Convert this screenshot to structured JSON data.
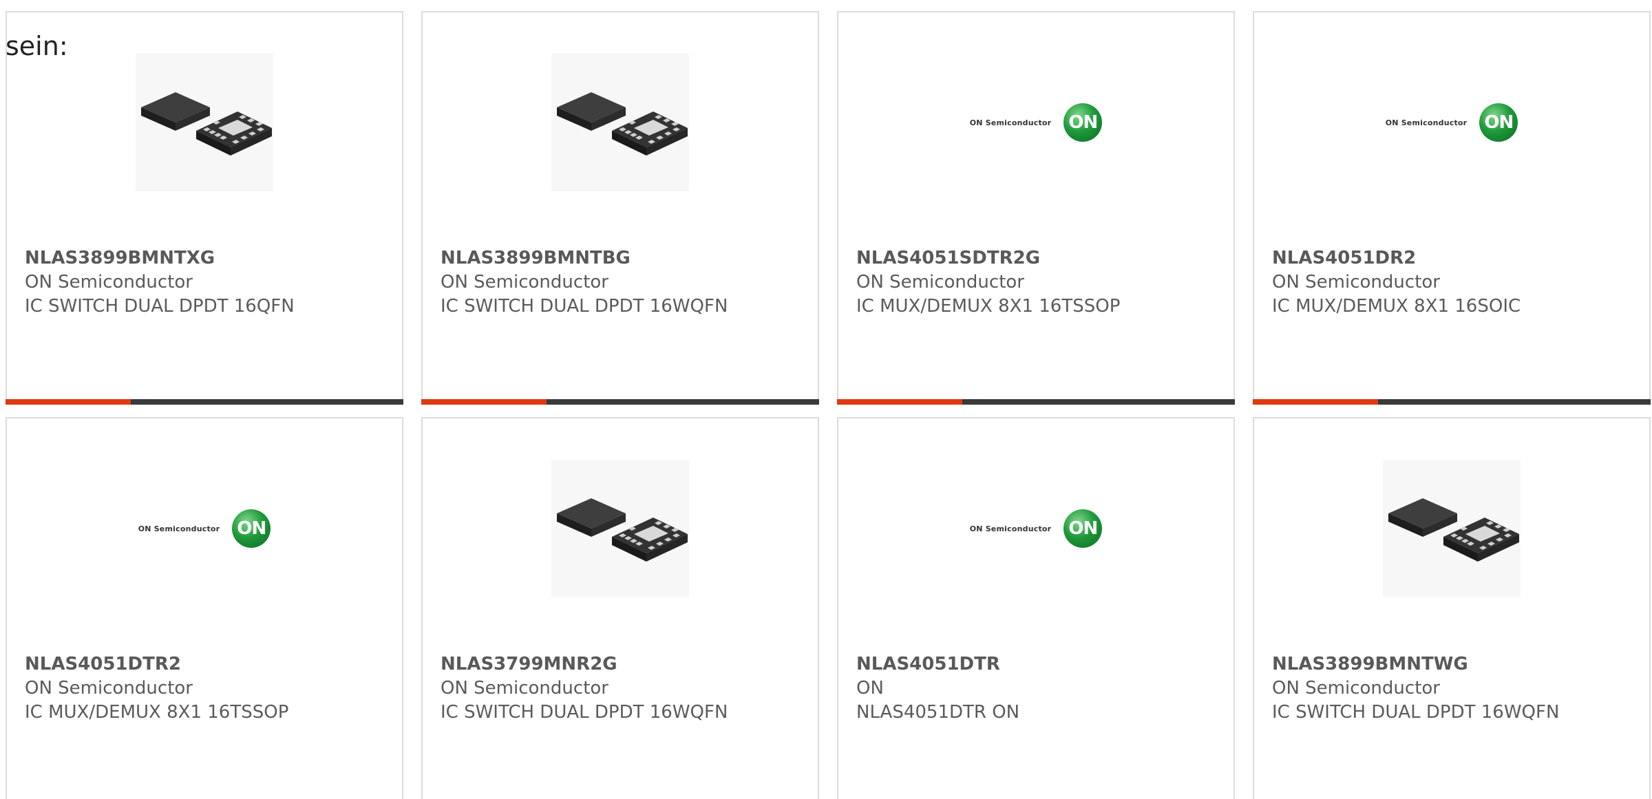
{
  "intro_text": "sein:",
  "logo": {
    "wordmark": "ON Semiconductor",
    "badge": "ON"
  },
  "colors": {
    "accent": "#e03a10",
    "bar": "#3a3a3a",
    "text": "#5a5a5a",
    "border": "#dcdcdc"
  },
  "cards": [
    {
      "part": "NLAS3899BMNTXG",
      "manufacturer": "ON Semiconductor",
      "description": "IC SWITCH DUAL DPDT 16QFN",
      "image": "chip-photo"
    },
    {
      "part": "NLAS3899BMNTBG",
      "manufacturer": "ON Semiconductor",
      "description": "IC SWITCH DUAL DPDT 16WQFN",
      "image": "chip-photo"
    },
    {
      "part": "NLAS4051SDTR2G",
      "manufacturer": "ON Semiconductor",
      "description": "IC MUX/DEMUX 8X1 16TSSOP",
      "image": "on-logo"
    },
    {
      "part": "NLAS4051DR2",
      "manufacturer": "ON Semiconductor",
      "description": "IC MUX/DEMUX 8X1 16SOIC",
      "image": "on-logo"
    },
    {
      "part": "NLAS4051DTR2",
      "manufacturer": "ON Semiconductor",
      "description": "IC MUX/DEMUX 8X1 16TSSOP",
      "image": "on-logo"
    },
    {
      "part": "NLAS3799MNR2G",
      "manufacturer": "ON Semiconductor",
      "description": "IC SWITCH DUAL DPDT 16WQFN",
      "image": "chip-photo"
    },
    {
      "part": "NLAS4051DTR",
      "manufacturer": "ON",
      "description": "NLAS4051DTR ON",
      "image": "on-logo"
    },
    {
      "part": "NLAS3899BMNTWG",
      "manufacturer": "ON Semiconductor",
      "description": "IC SWITCH DUAL DPDT 16WQFN",
      "image": "chip-photo"
    }
  ]
}
